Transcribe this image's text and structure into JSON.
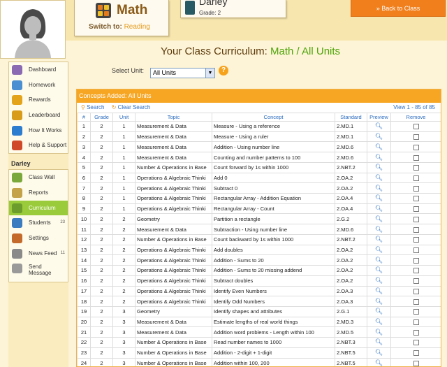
{
  "header": {
    "subject": "Math",
    "switch_label": "Switch to:",
    "switch_target": "Reading",
    "student_name": "Darley",
    "student_grade": "Grade: 2",
    "back_button": "» Back to Class"
  },
  "sidebar": {
    "top_items": [
      {
        "label": "Dashboard",
        "icon": "dashboard-icon",
        "color": "#8a6ab3"
      },
      {
        "label": "Homework",
        "icon": "homework-icon",
        "color": "#4a8fd1"
      },
      {
        "label": "Rewards",
        "icon": "rewards-icon",
        "color": "#e3a41c"
      },
      {
        "label": "Leaderboard",
        "icon": "trophy-icon",
        "color": "#d89b1a"
      },
      {
        "label": "How It Works",
        "icon": "help-circle-icon",
        "color": "#2c7ccf"
      },
      {
        "label": "Help & Support",
        "icon": "support-icon",
        "color": "#d04a2a"
      }
    ],
    "section_name": "Darley",
    "student_items": [
      {
        "label": "Class Wall",
        "icon": "class-wall-icon",
        "color": "#7aa83a",
        "badge": ""
      },
      {
        "label": "Reports",
        "icon": "reports-icon",
        "color": "#c3a24a",
        "badge": ""
      },
      {
        "label": "Curriculum",
        "icon": "curriculum-icon",
        "color": "#6c9c2c",
        "badge": "",
        "active": true
      },
      {
        "label": "Students",
        "icon": "students-icon",
        "color": "#3b7bc0",
        "badge": "23"
      },
      {
        "label": "Settings",
        "icon": "settings-icon",
        "color": "#c46a2a",
        "badge": ""
      },
      {
        "label": "News Feed",
        "icon": "news-feed-icon",
        "color": "#8a8a8a",
        "badge": "11"
      },
      {
        "label": "Send Message",
        "icon": "mail-icon",
        "color": "#9a9a9a",
        "badge": ""
      }
    ]
  },
  "main": {
    "title_prefix": "Your Class Curriculum:",
    "title_highlight": "Math / All Units",
    "select_unit_label": "Select Unit:",
    "select_unit_value": "All Units",
    "panel_title": "Concepts Added: All Units",
    "search_label": "Search",
    "clear_search_label": "Clear Search",
    "record_count": "View 1 - 85 of 85",
    "columns": [
      "#",
      "Grade",
      "Unit",
      "Topic",
      "Concept",
      "Standard",
      "Preview",
      "Remove"
    ],
    "rows": [
      [
        "1",
        "2",
        "1",
        "Measurement & Data",
        "Measure - Using a reference",
        "2.MD.1"
      ],
      [
        "2",
        "2",
        "1",
        "Measurement & Data",
        "Measure - Using a ruler",
        "2.MD.1"
      ],
      [
        "3",
        "2",
        "1",
        "Measurement & Data",
        "Addition - Using number line",
        "2.MD.6"
      ],
      [
        "4",
        "2",
        "1",
        "Measurement & Data",
        "Counting and number patterns to 100",
        "2.MD.6"
      ],
      [
        "5",
        "2",
        "1",
        "Number & Operations in Base",
        "Count forward by 1s within 1000",
        "2.NBT.2"
      ],
      [
        "6",
        "2",
        "1",
        "Operations & Algebraic Thinki",
        "Add 0",
        "2.OA.2"
      ],
      [
        "7",
        "2",
        "1",
        "Operations & Algebraic Thinki",
        "Subtract 0",
        "2.OA.2"
      ],
      [
        "8",
        "2",
        "1",
        "Operations & Algebraic Thinki",
        "Rectangular Array - Addition Equation",
        "2.OA.4"
      ],
      [
        "9",
        "2",
        "1",
        "Operations & Algebraic Thinki",
        "Rectangular Array - Count",
        "2.OA.4"
      ],
      [
        "10",
        "2",
        "2",
        "Geometry",
        "Partition a rectangle",
        "2.G.2"
      ],
      [
        "11",
        "2",
        "2",
        "Measurement & Data",
        "Subtraction - Using number line",
        "2.MD.6"
      ],
      [
        "12",
        "2",
        "2",
        "Number & Operations in Base",
        "Count backward by 1s within 1000",
        "2.NBT.2"
      ],
      [
        "13",
        "2",
        "2",
        "Operations & Algebraic Thinki",
        "Add doubles",
        "2.OA.2"
      ],
      [
        "14",
        "2",
        "2",
        "Operations & Algebraic Thinki",
        "Addition - Sums to 20",
        "2.OA.2"
      ],
      [
        "15",
        "2",
        "2",
        "Operations & Algebraic Thinki",
        "Addition - Sums to 20 missing addend",
        "2.OA.2"
      ],
      [
        "16",
        "2",
        "2",
        "Operations & Algebraic Thinki",
        "Subtract doubles",
        "2.OA.2"
      ],
      [
        "17",
        "2",
        "2",
        "Operations & Algebraic Thinki",
        "Identify Even Numbers",
        "2.OA.3"
      ],
      [
        "18",
        "2",
        "2",
        "Operations & Algebraic Thinki",
        "Identify Odd Numbers",
        "2.OA.3"
      ],
      [
        "19",
        "2",
        "3",
        "Geometry",
        "Identify shapes and attributes",
        "2.G.1"
      ],
      [
        "20",
        "2",
        "3",
        "Measurement & Data",
        "Estimate lengths of real world things",
        "2.MD.3"
      ],
      [
        "21",
        "2",
        "3",
        "Measurement & Data",
        "Addition word problems - Length within 100",
        "2.MD.5"
      ],
      [
        "22",
        "2",
        "3",
        "Number & Operations in Base",
        "Read number names to 1000",
        "2.NBT.3"
      ],
      [
        "23",
        "2",
        "3",
        "Number & Operations in Base",
        "Addition - 2-digit + 1-digit",
        "2.NBT.5"
      ],
      [
        "24",
        "2",
        "3",
        "Number & Operations in Base",
        "Addition within 100, 200",
        "2.NBT.5"
      ]
    ]
  },
  "colors": {
    "accent_orange": "#f6a623",
    "active_green": "#9acb3a",
    "link_blue": "#2c6cbf",
    "title_green": "#4ea50a"
  }
}
